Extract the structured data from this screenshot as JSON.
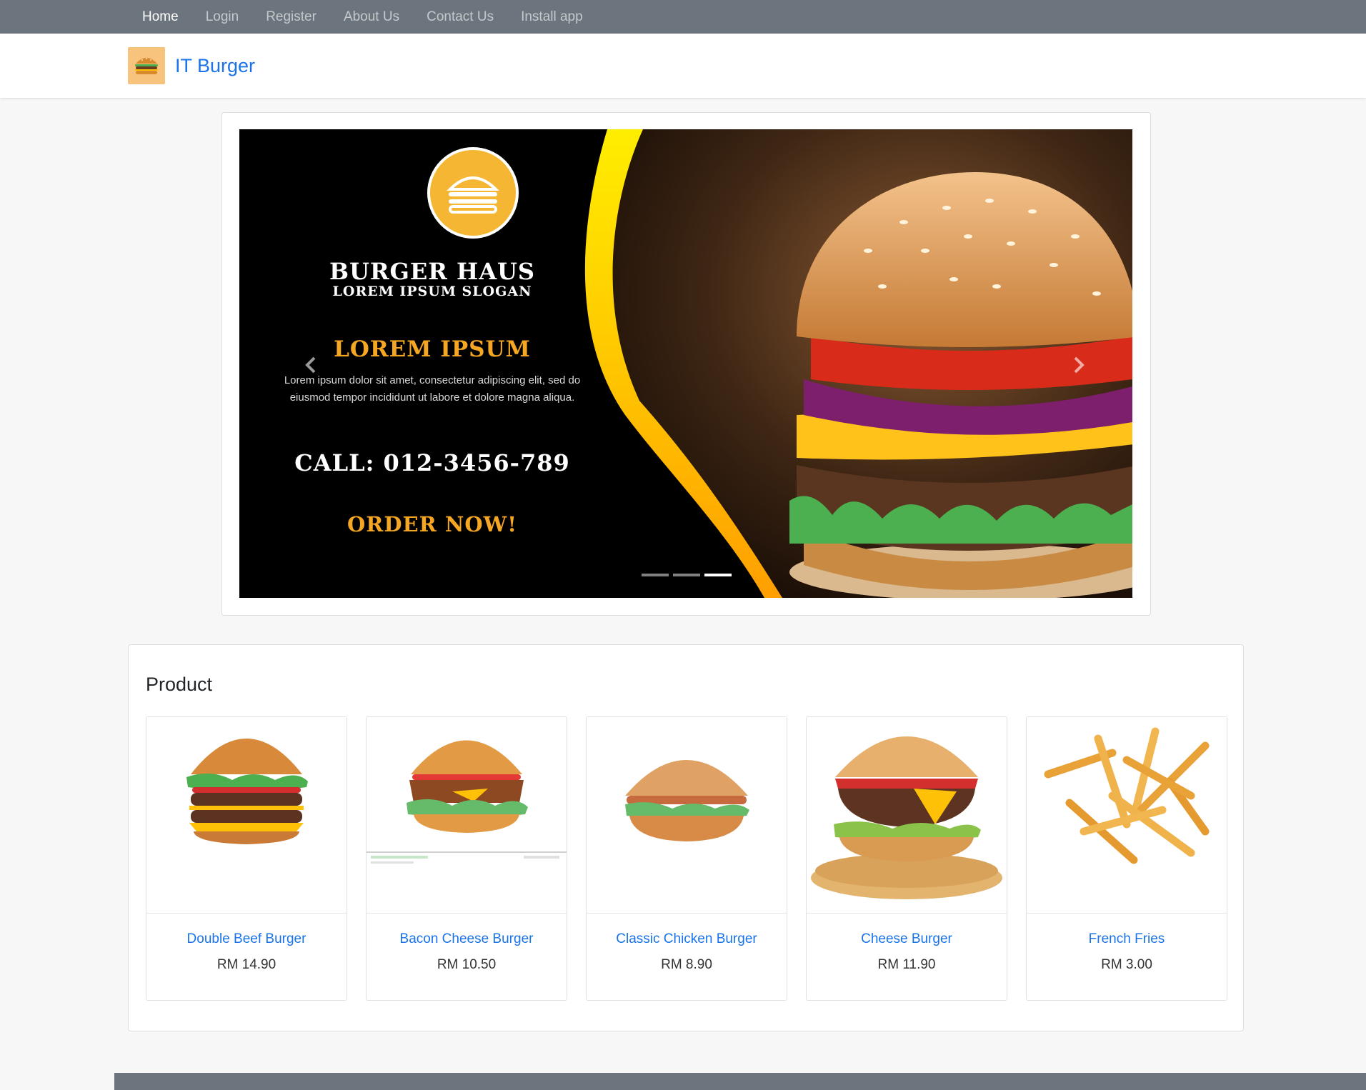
{
  "nav": {
    "items": [
      {
        "label": "Home",
        "active": true
      },
      {
        "label": "Login"
      },
      {
        "label": "Register"
      },
      {
        "label": "About Us"
      },
      {
        "label": "Contact Us"
      },
      {
        "label": "Install app"
      }
    ]
  },
  "brand": {
    "name": "IT Burger",
    "logo_icon": "burger-icon"
  },
  "carousel": {
    "slide": {
      "brand": "BURGER HAUS",
      "slogan": "LOREM IPSUM SLOGAN",
      "heading": "LOREM IPSUM",
      "body": "Lorem ipsum dolor sit amet, consectetur adipiscing elit, sed do eiusmod tempor incididunt ut labore et dolore magna aliqua.",
      "call": "CALL: 012-3456-789",
      "cta": "ORDER NOW!"
    },
    "prev_icon": "chevron-left-icon",
    "next_icon": "chevron-right-icon",
    "slide_count": 3,
    "active_index": 2
  },
  "products": {
    "title": "Product",
    "items": [
      {
        "name": "Double Beef Burger",
        "price": "RM 14.90"
      },
      {
        "name": "Bacon Cheese Burger",
        "price": "RM 10.50"
      },
      {
        "name": "Classic Chicken Burger",
        "price": "RM 8.90"
      },
      {
        "name": "Cheese Burger",
        "price": "RM 11.90"
      },
      {
        "name": "French Fries",
        "price": "RM 3.00"
      }
    ]
  },
  "colors": {
    "nav_bg": "#6c757d",
    "brand_blue": "#1a73e8",
    "accent_orange": "#f5a623",
    "swoosh_yellow": "#ffee00"
  }
}
